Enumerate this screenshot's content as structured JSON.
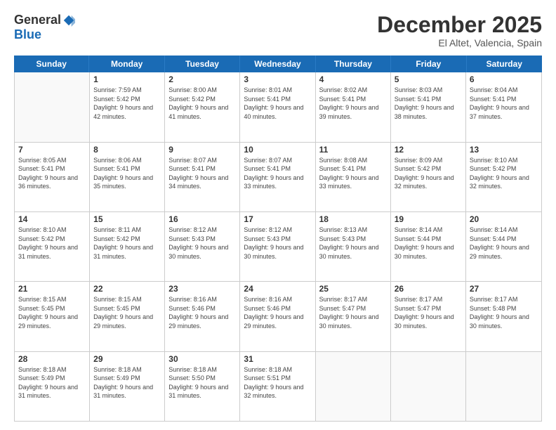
{
  "logo": {
    "general": "General",
    "blue": "Blue"
  },
  "title": "December 2025",
  "location": "El Altet, Valencia, Spain",
  "header_days": [
    "Sunday",
    "Monday",
    "Tuesday",
    "Wednesday",
    "Thursday",
    "Friday",
    "Saturday"
  ],
  "weeks": [
    [
      {
        "day": null
      },
      {
        "day": "1",
        "sunrise": "7:59 AM",
        "sunset": "5:42 PM",
        "daylight": "9 hours and 42 minutes."
      },
      {
        "day": "2",
        "sunrise": "8:00 AM",
        "sunset": "5:42 PM",
        "daylight": "9 hours and 41 minutes."
      },
      {
        "day": "3",
        "sunrise": "8:01 AM",
        "sunset": "5:41 PM",
        "daylight": "9 hours and 40 minutes."
      },
      {
        "day": "4",
        "sunrise": "8:02 AM",
        "sunset": "5:41 PM",
        "daylight": "9 hours and 39 minutes."
      },
      {
        "day": "5",
        "sunrise": "8:03 AM",
        "sunset": "5:41 PM",
        "daylight": "9 hours and 38 minutes."
      },
      {
        "day": "6",
        "sunrise": "8:04 AM",
        "sunset": "5:41 PM",
        "daylight": "9 hours and 37 minutes."
      }
    ],
    [
      {
        "day": "7",
        "sunrise": "8:05 AM",
        "sunset": "5:41 PM",
        "daylight": "9 hours and 36 minutes."
      },
      {
        "day": "8",
        "sunrise": "8:06 AM",
        "sunset": "5:41 PM",
        "daylight": "9 hours and 35 minutes."
      },
      {
        "day": "9",
        "sunrise": "8:07 AM",
        "sunset": "5:41 PM",
        "daylight": "9 hours and 34 minutes."
      },
      {
        "day": "10",
        "sunrise": "8:07 AM",
        "sunset": "5:41 PM",
        "daylight": "9 hours and 33 minutes."
      },
      {
        "day": "11",
        "sunrise": "8:08 AM",
        "sunset": "5:41 PM",
        "daylight": "9 hours and 33 minutes."
      },
      {
        "day": "12",
        "sunrise": "8:09 AM",
        "sunset": "5:42 PM",
        "daylight": "9 hours and 32 minutes."
      },
      {
        "day": "13",
        "sunrise": "8:10 AM",
        "sunset": "5:42 PM",
        "daylight": "9 hours and 32 minutes."
      }
    ],
    [
      {
        "day": "14",
        "sunrise": "8:10 AM",
        "sunset": "5:42 PM",
        "daylight": "9 hours and 31 minutes."
      },
      {
        "day": "15",
        "sunrise": "8:11 AM",
        "sunset": "5:42 PM",
        "daylight": "9 hours and 31 minutes."
      },
      {
        "day": "16",
        "sunrise": "8:12 AM",
        "sunset": "5:43 PM",
        "daylight": "9 hours and 30 minutes."
      },
      {
        "day": "17",
        "sunrise": "8:12 AM",
        "sunset": "5:43 PM",
        "daylight": "9 hours and 30 minutes."
      },
      {
        "day": "18",
        "sunrise": "8:13 AM",
        "sunset": "5:43 PM",
        "daylight": "9 hours and 30 minutes."
      },
      {
        "day": "19",
        "sunrise": "8:14 AM",
        "sunset": "5:44 PM",
        "daylight": "9 hours and 30 minutes."
      },
      {
        "day": "20",
        "sunrise": "8:14 AM",
        "sunset": "5:44 PM",
        "daylight": "9 hours and 29 minutes."
      }
    ],
    [
      {
        "day": "21",
        "sunrise": "8:15 AM",
        "sunset": "5:45 PM",
        "daylight": "9 hours and 29 minutes."
      },
      {
        "day": "22",
        "sunrise": "8:15 AM",
        "sunset": "5:45 PM",
        "daylight": "9 hours and 29 minutes."
      },
      {
        "day": "23",
        "sunrise": "8:16 AM",
        "sunset": "5:46 PM",
        "daylight": "9 hours and 29 minutes."
      },
      {
        "day": "24",
        "sunrise": "8:16 AM",
        "sunset": "5:46 PM",
        "daylight": "9 hours and 29 minutes."
      },
      {
        "day": "25",
        "sunrise": "8:17 AM",
        "sunset": "5:47 PM",
        "daylight": "9 hours and 30 minutes."
      },
      {
        "day": "26",
        "sunrise": "8:17 AM",
        "sunset": "5:47 PM",
        "daylight": "9 hours and 30 minutes."
      },
      {
        "day": "27",
        "sunrise": "8:17 AM",
        "sunset": "5:48 PM",
        "daylight": "9 hours and 30 minutes."
      }
    ],
    [
      {
        "day": "28",
        "sunrise": "8:18 AM",
        "sunset": "5:49 PM",
        "daylight": "9 hours and 31 minutes."
      },
      {
        "day": "29",
        "sunrise": "8:18 AM",
        "sunset": "5:49 PM",
        "daylight": "9 hours and 31 minutes."
      },
      {
        "day": "30",
        "sunrise": "8:18 AM",
        "sunset": "5:50 PM",
        "daylight": "9 hours and 31 minutes."
      },
      {
        "day": "31",
        "sunrise": "8:18 AM",
        "sunset": "5:51 PM",
        "daylight": "9 hours and 32 minutes."
      },
      {
        "day": null
      },
      {
        "day": null
      },
      {
        "day": null
      }
    ]
  ]
}
